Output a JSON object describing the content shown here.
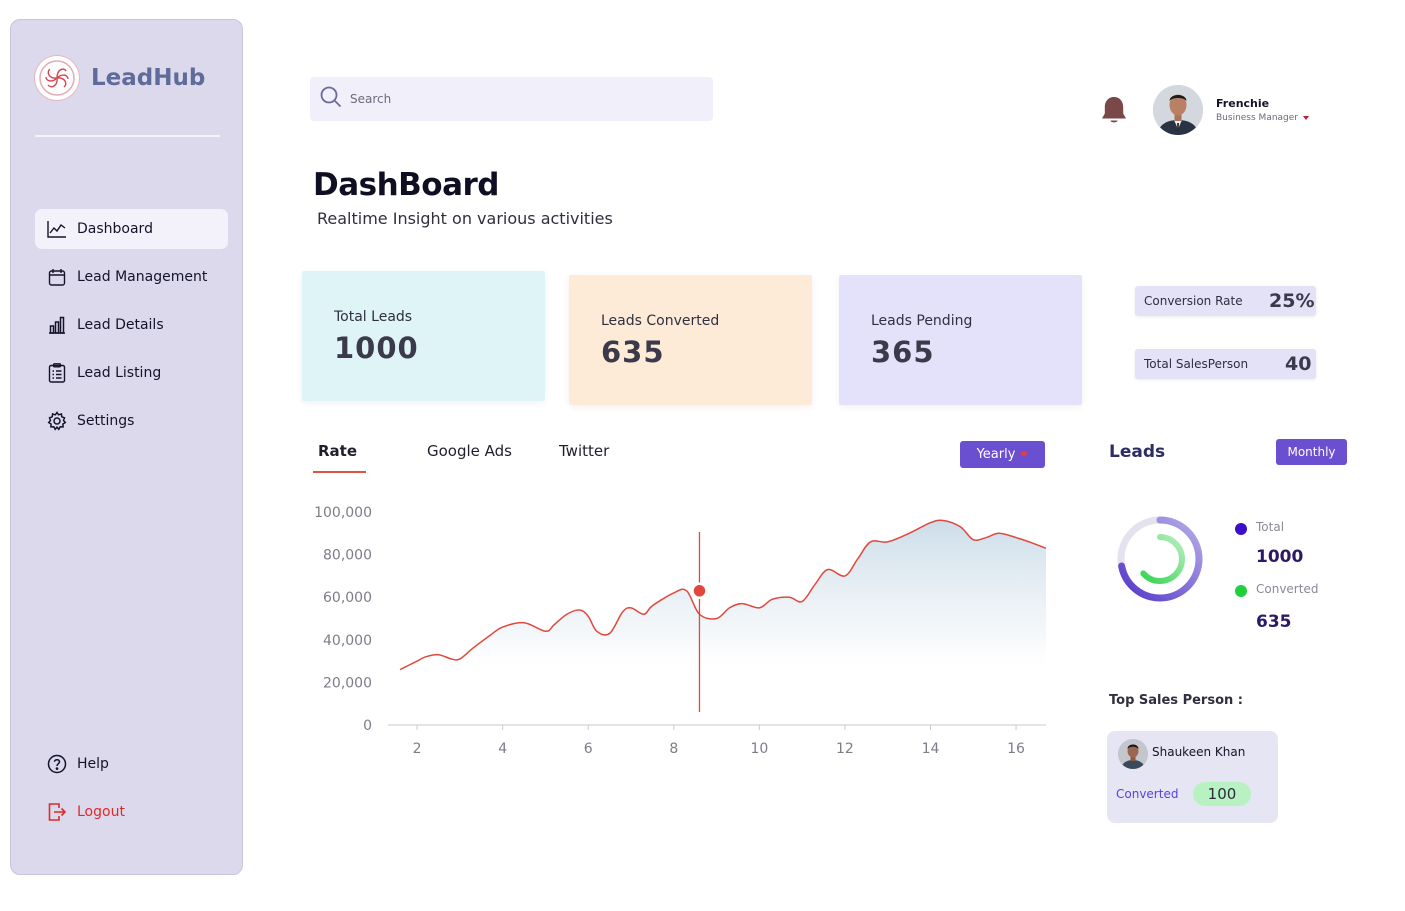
{
  "app": {
    "name": "LeadHub"
  },
  "sidebar": {
    "items": [
      {
        "label": "Dashboard",
        "icon": "line-chart-icon",
        "active": true
      },
      {
        "label": "Lead Management",
        "icon": "calendar-icon"
      },
      {
        "label": "Lead Details",
        "icon": "bar-chart-icon"
      },
      {
        "label": "Lead Listing",
        "icon": "clipboard-list-icon"
      },
      {
        "label": "Settings",
        "icon": "gear-icon"
      }
    ],
    "footer": [
      {
        "label": "Help",
        "icon": "help-circle-icon"
      },
      {
        "label": "Logout",
        "icon": "logout-icon",
        "color": "#e02a2a"
      }
    ]
  },
  "search": {
    "placeholder": "Search",
    "value": ""
  },
  "user": {
    "name": "Frenchie",
    "role": "Business Manager"
  },
  "page": {
    "title": "DashBoard",
    "subtitle": "Realtime Insight on various activities"
  },
  "stats": [
    {
      "label": "Total Leads",
      "value": "1000",
      "color": "#dff4f6"
    },
    {
      "label": "Leads Converted",
      "value": "635",
      "color": "#fdebd8"
    },
    {
      "label": "Leads Pending",
      "value": "365",
      "color": "#e4e2fb"
    }
  ],
  "mini_stats": [
    {
      "label": "Conversion Rate",
      "value": "25%"
    },
    {
      "label": "Total SalesPerson",
      "value": "40"
    }
  ],
  "chart_tabs": {
    "items": [
      "Rate",
      "Google Ads",
      "Twitter"
    ],
    "active": "Rate"
  },
  "period_filter": "Yearly",
  "chart_data": {
    "type": "area",
    "x": [
      1.6,
      1.8,
      2.0,
      2.2,
      2.5,
      2.8,
      3.0,
      3.3,
      3.7,
      4.0,
      4.5,
      5.0,
      5.2,
      5.5,
      5.8,
      6.0,
      6.2,
      6.5,
      6.8,
      7.0,
      7.3,
      7.5,
      8.0,
      8.3,
      8.6,
      9.0,
      9.3,
      9.6,
      10.0,
      10.3,
      10.7,
      11.0,
      11.3,
      11.6,
      12.0,
      12.3,
      12.6,
      13.0,
      13.5,
      14.0,
      14.3,
      14.7,
      15.0,
      15.3,
      15.6,
      16.0,
      16.3,
      16.7
    ],
    "y": [
      26000,
      28000,
      30000,
      32000,
      33000,
      31000,
      31000,
      36000,
      42000,
      46000,
      48000,
      44000,
      47000,
      52000,
      54000,
      51000,
      44000,
      43000,
      53000,
      55000,
      52000,
      56000,
      62000,
      63000,
      52000,
      50000,
      55000,
      57000,
      55000,
      59000,
      60000,
      58000,
      66000,
      73000,
      70000,
      78000,
      86000,
      86000,
      90000,
      95000,
      96000,
      93000,
      87000,
      88000,
      90000,
      88000,
      86000,
      83000
    ],
    "highlight": {
      "x": 8.6,
      "y": 63000
    },
    "xticks": [
      2,
      4,
      6,
      8,
      10,
      12,
      14,
      16
    ],
    "yticks": [
      0,
      20000,
      40000,
      60000,
      80000,
      100000
    ],
    "ytick_labels": [
      "0",
      "20,000",
      "40,000",
      "60,000",
      "80,000",
      "100,000"
    ],
    "xlim": [
      1.6,
      16.7
    ],
    "ylim": [
      0,
      100000
    ],
    "line_color": "#e0483c",
    "fill_color": "#c9dbe8"
  },
  "leads_panel": {
    "title": "Leads",
    "period": "Monthly",
    "legend": [
      {
        "label": "Total",
        "value": "1000",
        "color": "#3a0fc7"
      },
      {
        "label": "Converted",
        "value": "635",
        "color": "#1fcf3b"
      }
    ],
    "donut": {
      "total": 1000,
      "converted": 635
    }
  },
  "top_sales": {
    "title": "Top Sales Person :",
    "name": "Shaukeen Khan",
    "metric_label": "Converted",
    "metric_value": "100"
  }
}
